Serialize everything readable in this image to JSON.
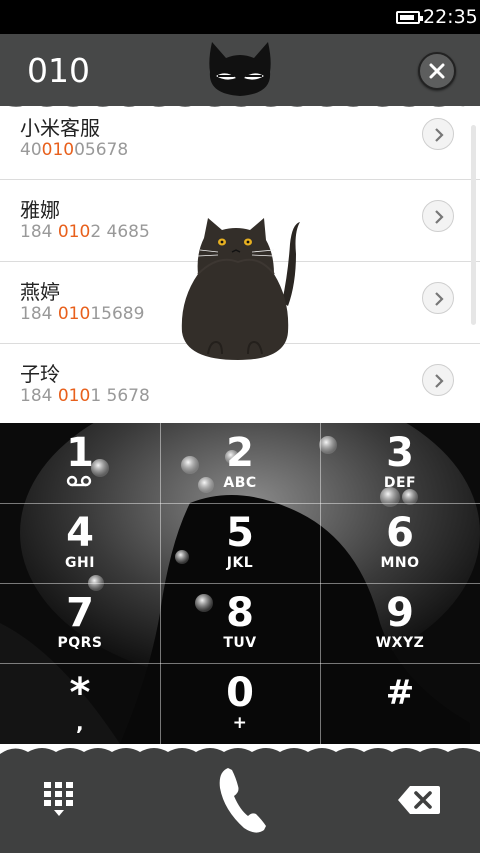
{
  "status_bar": {
    "time": "22:35"
  },
  "header": {
    "dialed_number": "010"
  },
  "contacts": [
    {
      "name": "小米客服",
      "number_pre": "40",
      "number_match": "010",
      "number_post": "05678"
    },
    {
      "name": "雅娜",
      "number_pre": "184 ",
      "number_match": "010",
      "number_post": "2 4685"
    },
    {
      "name": "燕婷",
      "number_pre": "184 ",
      "number_match": "010",
      "number_post": "15689"
    },
    {
      "name": "子玲",
      "number_pre": "184 ",
      "number_match": "010",
      "number_post": "1 5678"
    }
  ],
  "keypad": [
    {
      "digit": "1",
      "letters": "",
      "icon": "voicemail-icon"
    },
    {
      "digit": "2",
      "letters": "ABC"
    },
    {
      "digit": "3",
      "letters": "DEF"
    },
    {
      "digit": "4",
      "letters": "GHI"
    },
    {
      "digit": "5",
      "letters": "JKL"
    },
    {
      "digit": "6",
      "letters": "MNO"
    },
    {
      "digit": "7",
      "letters": "PQRS"
    },
    {
      "digit": "8",
      "letters": "TUV"
    },
    {
      "digit": "9",
      "letters": "WXYZ"
    },
    {
      "digit": "*",
      "letters": ","
    },
    {
      "digit": "0",
      "letters": "+"
    },
    {
      "digit": "#",
      "letters": ""
    }
  ],
  "colors": {
    "match_highlight": "#e8601c",
    "header_bg": "#474848",
    "bottom_bar_bg": "#3f4040"
  },
  "icons": [
    "battery-icon",
    "cat-head-icon",
    "clear-icon",
    "chevron-right-icon",
    "cat-illustration",
    "voicemail-icon",
    "dialpad-toggle-icon",
    "phone-call-icon",
    "backspace-icon"
  ]
}
